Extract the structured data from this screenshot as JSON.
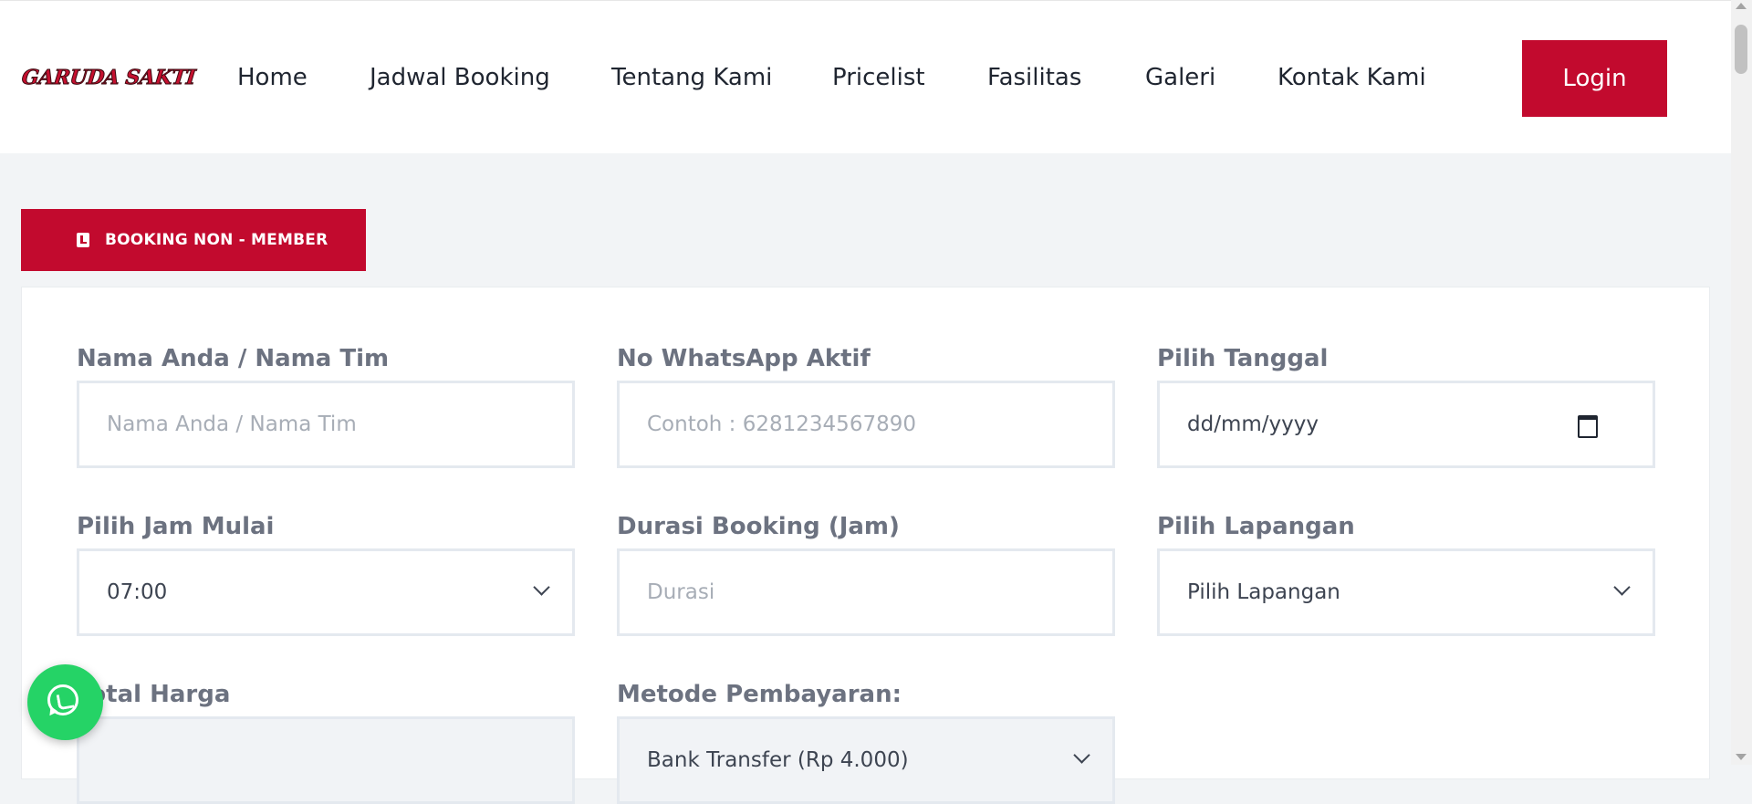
{
  "brand": {
    "logo_text": "GARUDA SAKTI"
  },
  "nav": {
    "items": [
      {
        "label": "Home"
      },
      {
        "label": "Jadwal Booking"
      },
      {
        "label": "Tentang Kami"
      },
      {
        "label": "Pricelist"
      },
      {
        "label": "Fasilitas"
      },
      {
        "label": "Galeri"
      },
      {
        "label": "Kontak Kami"
      }
    ],
    "login_label": "Login"
  },
  "tab": {
    "label": "BOOKING NON - MEMBER",
    "icon": "book-icon"
  },
  "form": {
    "nama": {
      "label": "Nama Anda / Nama Tim",
      "placeholder": "Nama Anda / Nama Tim",
      "value": ""
    },
    "whatsapp": {
      "label": "No WhatsApp Aktif",
      "placeholder": "Contoh : 6281234567890",
      "value": ""
    },
    "tanggal": {
      "label": "Pilih Tanggal",
      "display": "dd/mm/yyyy",
      "icon": "calendar-icon"
    },
    "jam_mulai": {
      "label": "Pilih Jam Mulai",
      "selected": "07:00"
    },
    "durasi": {
      "label": "Durasi Booking (Jam)",
      "placeholder": "Durasi",
      "value": ""
    },
    "lapangan": {
      "label": "Pilih Lapangan",
      "selected": "Pilih Lapangan"
    },
    "total_harga": {
      "label": "Total Harga",
      "value": ""
    },
    "metode": {
      "label": "Metode Pembayaran:",
      "selected": "Bank Transfer (Rp 4.000)"
    }
  },
  "colors": {
    "brand_red": "#c20a2e",
    "whatsapp_green": "#25d366",
    "page_bg": "#f2f4f6",
    "label_gray": "#6c7280"
  },
  "floating": {
    "whatsapp_icon": "whatsapp-icon"
  }
}
